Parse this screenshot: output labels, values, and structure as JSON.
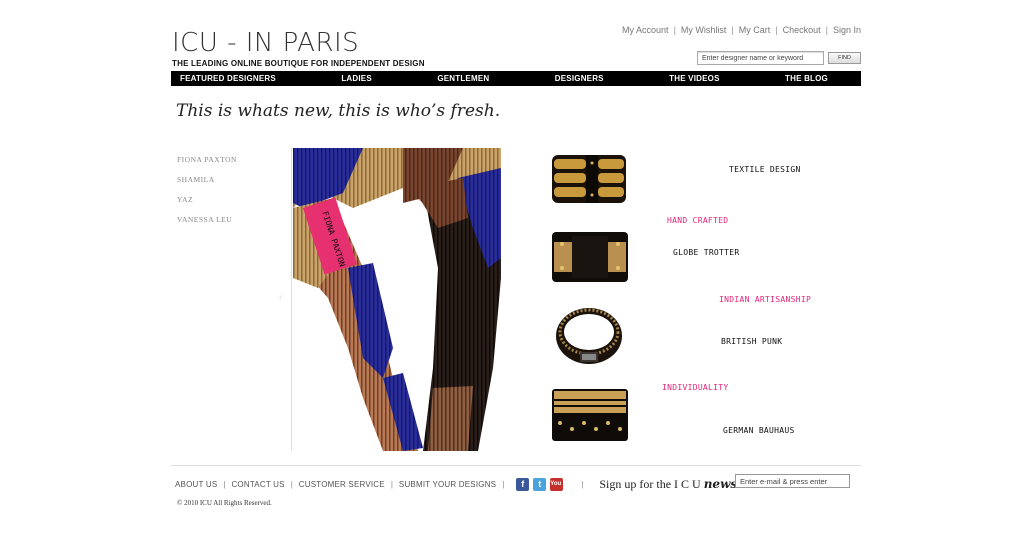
{
  "header": {
    "logo": "ICU - IN PARIS",
    "tagline": "THE LEADING ONLINE BOUTIQUE FOR INDEPENDENT DESIGN",
    "account_links": [
      "My Account",
      "My Wishlist",
      "My Cart",
      "Checkout",
      "Sign In"
    ],
    "search_placeholder": "Enter designer name or keyword",
    "search_button": "FIND"
  },
  "nav": [
    "FEATURED DESIGNERS",
    "LADIES",
    "GENTLEMEN",
    "DESIGNERS",
    "THE VIDEOS",
    "THE BLOG"
  ],
  "headline": "This is whats new, this is who’s fresh.",
  "designers": [
    "FIONA PAXTON",
    "SHAMILA",
    "YAZ",
    "VANESSA LEU"
  ],
  "hero_label": "FIONA PAXTON",
  "tags": {
    "textile": "TEXTILE DESIGN",
    "handcrafted": "HAND CRAFTED",
    "globe": "GLOBE TROTTER",
    "indian": "INDIAN ARTISANSHIP",
    "punk": "BRITISH PUNK",
    "individuality": "INDIVIDUALITY",
    "bauhaus": "GERMAN BAUHAUS"
  },
  "footer": {
    "links": [
      "ABOUT US",
      "CONTACT US",
      "CUSTOMER SERVICE",
      "SUBMIT YOUR DESIGNS"
    ],
    "social": {
      "facebook": "f",
      "twitter": "t",
      "youtube": "You Tube"
    },
    "signup_prefix": "Sign up for the I C U",
    "signup_word": "newsletter",
    "newsletter_placeholder": "Enter e-mail & press enter",
    "copyright": "© 2010 ICU All Rights Reserved."
  },
  "colors": {
    "accent_pink": "#e4257a",
    "nav_bg": "#000000"
  }
}
